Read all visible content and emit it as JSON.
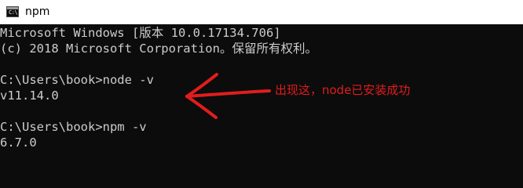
{
  "window": {
    "title": "npm",
    "icon": "terminal-icon",
    "icon_prompt": "C:\\"
  },
  "console": {
    "lines": [
      "Microsoft Windows [版本 10.0.17134.706]",
      "(c) 2018 Microsoft Corporation。保留所有权利。",
      "",
      "C:\\Users\\book>node -v",
      "v11.14.0",
      "",
      "C:\\Users\\book>npm -v",
      "6.7.0"
    ],
    "text_color": "#cccccc",
    "background": "#0c0c0c"
  },
  "annotation": {
    "text": "出现这，node已安装成功",
    "color": "#e11d1d",
    "arrow_icon": "hand-drawn-arrow-left"
  }
}
